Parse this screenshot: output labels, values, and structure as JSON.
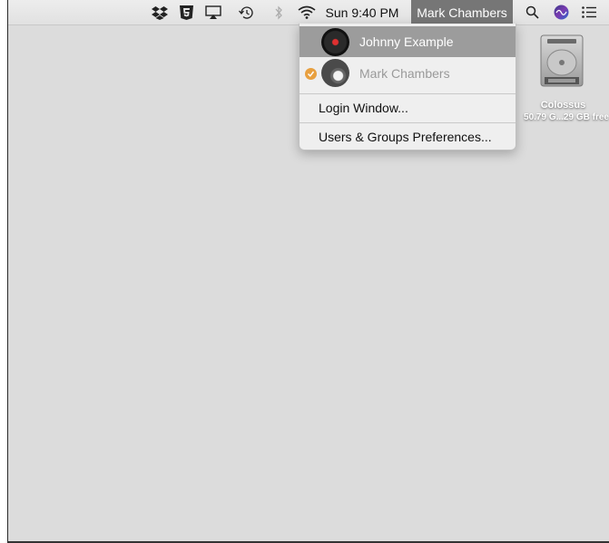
{
  "menubar": {
    "clock": "Sun 9:40 PM",
    "user_name": "Mark Chambers",
    "icons": [
      "dropbox-icon",
      "html5-icon",
      "airplay-icon",
      "time-machine-icon",
      "bluetooth-icon",
      "wifi-icon",
      "spotlight-icon",
      "siri-icon",
      "notification-center-icon"
    ]
  },
  "user_menu": {
    "users": [
      {
        "name": "Johnny Example",
        "highlighted": true,
        "current": false
      },
      {
        "name": "Mark Chambers",
        "highlighted": false,
        "current": true
      }
    ],
    "login_window": "Login Window...",
    "preferences": "Users & Groups Preferences..."
  },
  "desktop": {
    "disk": {
      "name": "Colossus",
      "info": "50.79 G...29 GB free"
    }
  },
  "colors": {
    "highlight": "#9c9c9c",
    "check": "#e8a040",
    "user_menu_bg": "#767676"
  }
}
